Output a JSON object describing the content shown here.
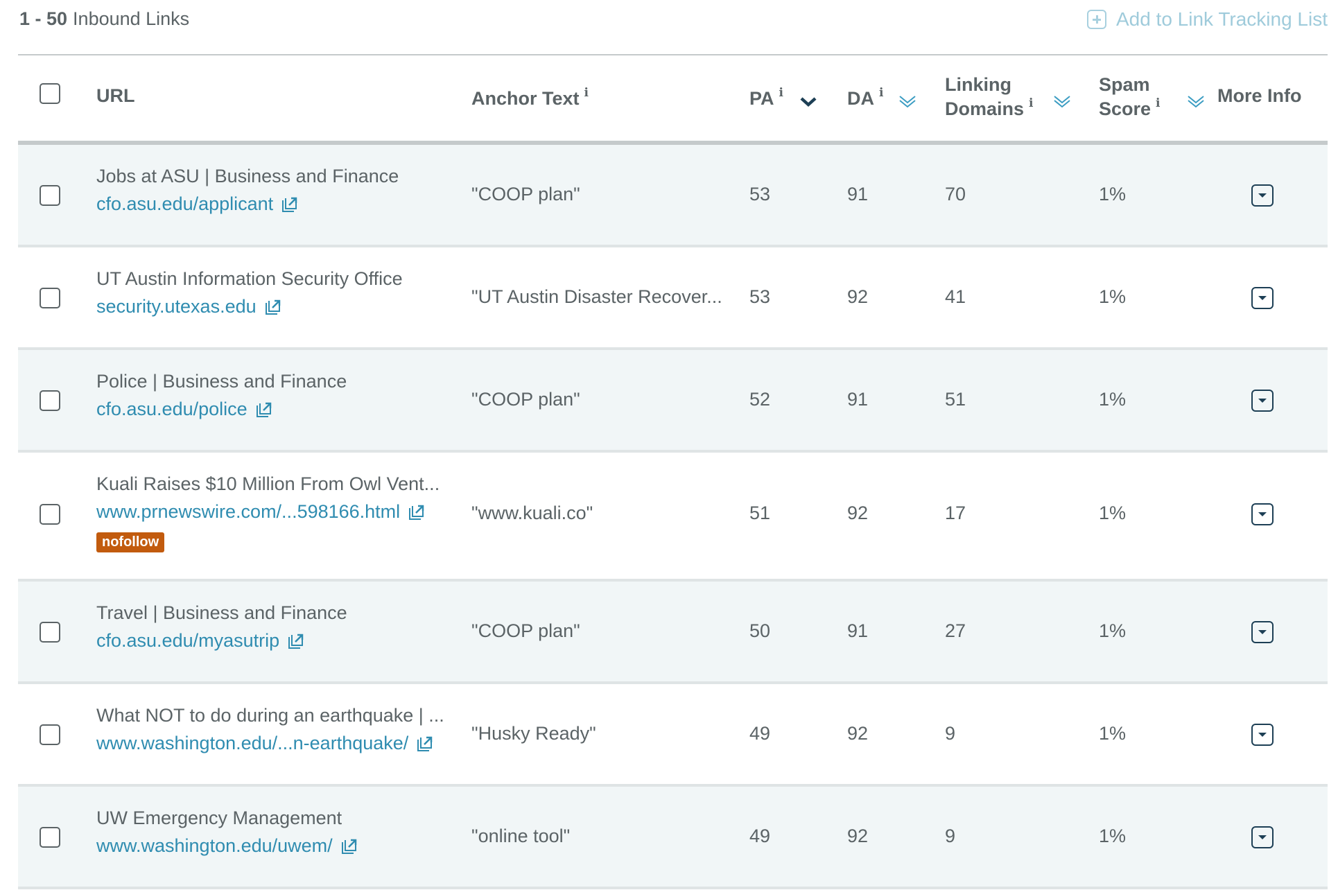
{
  "summary": {
    "range": "1 - 50",
    "label": "Inbound Links"
  },
  "actions": {
    "add_tracking": "Add to Link Tracking List",
    "add_icon": "plus-square-icon"
  },
  "colors": {
    "link": "#2f8cb0",
    "text": "#5b6366",
    "nofollow_badge": "#c25b0e",
    "row_alt_bg": "#f1f6f7",
    "sort_active": "#1d3f55",
    "sort_inactive": "#3a9cc2",
    "add_link": "#9fcbdb"
  },
  "columns": {
    "url": {
      "label": "URL"
    },
    "anchor": {
      "label": "Anchor Text",
      "info": "i"
    },
    "pa": {
      "label": "PA",
      "info": "i",
      "sort": "active-desc"
    },
    "da": {
      "label": "DA",
      "info": "i",
      "sort": "inactive"
    },
    "ld": {
      "label_line1": "Linking",
      "label_line2": "Domains",
      "info": "i",
      "sort": "inactive"
    },
    "spam": {
      "label_line1": "Spam",
      "label_line2": "Score",
      "info": "i",
      "sort": "inactive"
    },
    "more": {
      "label": "More Info"
    }
  },
  "rows": [
    {
      "title": "Jobs at ASU | Business and Finance",
      "url": "cfo.asu.edu/applicant",
      "anchor": "\"COOP plan\"",
      "pa": "53",
      "da": "91",
      "ld": "70",
      "spam": "1%",
      "badge": null
    },
    {
      "title": "UT Austin Information Security Office",
      "url": "security.utexas.edu",
      "anchor": "\"UT Austin Disaster Recover...",
      "pa": "53",
      "da": "92",
      "ld": "41",
      "spam": "1%",
      "badge": null
    },
    {
      "title": "Police | Business and Finance",
      "url": "cfo.asu.edu/police",
      "anchor": "\"COOP plan\"",
      "pa": "52",
      "da": "91",
      "ld": "51",
      "spam": "1%",
      "badge": null
    },
    {
      "title": "Kuali Raises $10 Million From Owl Vent...",
      "url": "www.prnewswire.com/...598166.html",
      "anchor": "\"www.kuali.co\"",
      "pa": "51",
      "da": "92",
      "ld": "17",
      "spam": "1%",
      "badge": "nofollow"
    },
    {
      "title": "Travel | Business and Finance",
      "url": "cfo.asu.edu/myasutrip",
      "anchor": "\"COOP plan\"",
      "pa": "50",
      "da": "91",
      "ld": "27",
      "spam": "1%",
      "badge": null
    },
    {
      "title": "What NOT to do during an earthquake | ...",
      "url": "www.washington.edu/...n-earthquake/",
      "anchor": "\"Husky Ready\"",
      "pa": "49",
      "da": "92",
      "ld": "9",
      "spam": "1%",
      "badge": null
    },
    {
      "title": "UW Emergency Management",
      "url": "www.washington.edu/uwem/",
      "anchor": "\"online tool\"",
      "pa": "49",
      "da": "92",
      "ld": "9",
      "spam": "1%",
      "badge": null
    }
  ]
}
